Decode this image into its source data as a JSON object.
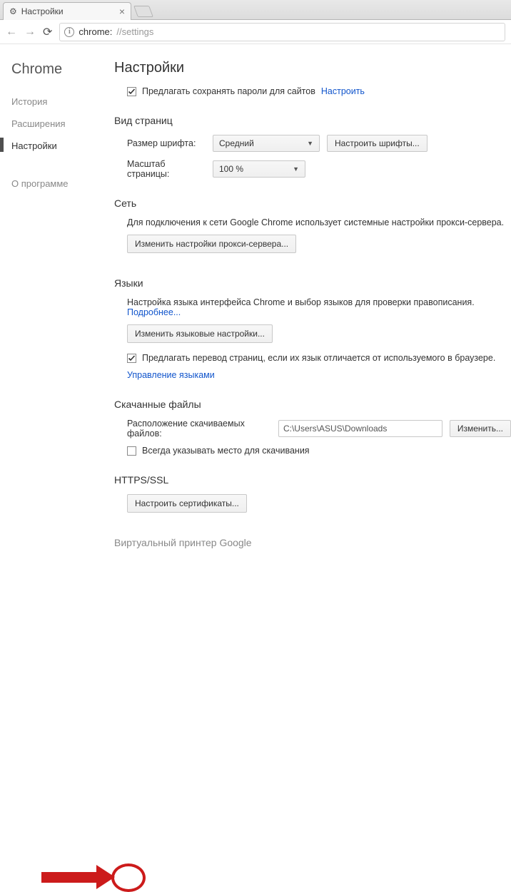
{
  "tab": {
    "title": "Настройки"
  },
  "url": {
    "host": "chrome:",
    "path": "//settings"
  },
  "sidebar": {
    "brand": "Chrome",
    "items": [
      {
        "label": "История",
        "active": false
      },
      {
        "label": "Расширения",
        "active": false
      },
      {
        "label": "Настройки",
        "active": true
      }
    ],
    "about": "О программе"
  },
  "page": {
    "title": "Настройки",
    "passwords": {
      "offer_label": "Предлагать сохранять пароли для сайтов",
      "configure_link": "Настроить"
    },
    "appearance": {
      "heading": "Вид страниц",
      "font_label": "Размер шрифта:",
      "font_value": "Средний",
      "font_btn": "Настроить шрифты...",
      "zoom_label": "Масштаб страницы:",
      "zoom_value": "100 %"
    },
    "network": {
      "heading": "Сеть",
      "help": "Для подключения к сети Google Chrome использует системные настройки прокси-сервера.",
      "proxy_btn": "Изменить настройки прокси-сервера..."
    },
    "languages": {
      "heading": "Языки",
      "help": "Настройка языка интерфейса Chrome и выбор языков для проверки правописания.",
      "more_link": "Подробнее...",
      "lang_btn": "Изменить языковые настройки...",
      "translate_label": "Предлагать перевод страниц, если их язык отличается от используемого в браузере.",
      "manage_link": "Управление языками"
    },
    "downloads": {
      "heading": "Скачанные файлы",
      "location_label": "Расположение скачиваемых файлов:",
      "location_value": "C:\\Users\\ASUS\\Downloads",
      "change_btn": "Изменить...",
      "ask_label": "Всегда указывать место для скачивания"
    },
    "ssl": {
      "heading": "HTTPS/SSL",
      "certs_btn": "Настроить сертификаты..."
    },
    "printer": {
      "heading": "Виртуальный принтер Google"
    }
  }
}
